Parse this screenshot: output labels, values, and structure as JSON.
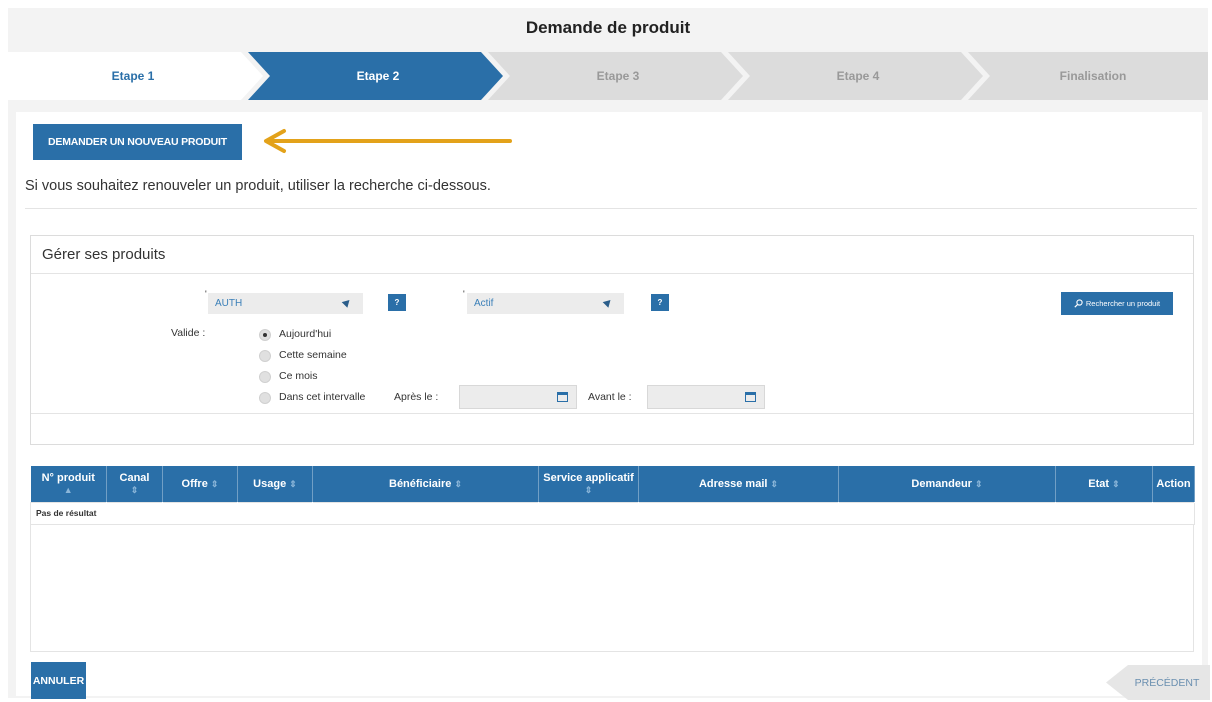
{
  "page": {
    "title": "Demande de produit"
  },
  "steps": [
    {
      "label": "Etape 1",
      "state": "done"
    },
    {
      "label": "Etape 2",
      "state": "active"
    },
    {
      "label": "Etape 3",
      "state": "pending"
    },
    {
      "label": "Etape 4",
      "state": "pending"
    },
    {
      "label": "Finalisation",
      "state": "pending"
    }
  ],
  "actions": {
    "new_product": "DEMANDER UN NOUVEAU PRODUIT"
  },
  "info_text": "Si vous souhaitez renouveler un produit, utiliser la recherche ci-dessous.",
  "panel": {
    "title": "Gérer ses produits",
    "select1": {
      "value": "AUTH",
      "help": "?"
    },
    "select2": {
      "value": "Actif",
      "help": "?"
    },
    "search_button": "Rechercher un produit",
    "valid_label": "Valide :",
    "radios": [
      {
        "label": "Aujourd'hui",
        "checked": true
      },
      {
        "label": "Cette semaine",
        "checked": false
      },
      {
        "label": "Ce mois",
        "checked": false
      },
      {
        "label": "Dans cet intervalle",
        "checked": false
      }
    ],
    "after_label": "Après le :",
    "before_label": "Avant le :"
  },
  "table": {
    "columns": [
      {
        "label": "N° produit",
        "sort": "▲"
      },
      {
        "label": "Canal",
        "sort": "⇕"
      },
      {
        "label": "Offre",
        "sort": "⇕"
      },
      {
        "label": "Usage",
        "sort": "⇕"
      },
      {
        "label": "Bénéficiaire",
        "sort": "⇕"
      },
      {
        "label": "Service applicatif",
        "sort": "⇕"
      },
      {
        "label": "Adresse mail",
        "sort": "⇕"
      },
      {
        "label": "Demandeur",
        "sort": "⇕"
      },
      {
        "label": "Etat",
        "sort": "⇕"
      },
      {
        "label": "Action",
        "sort": ""
      }
    ],
    "empty": "Pas de résultat"
  },
  "footer": {
    "cancel": "ANNULER",
    "previous": "PRÉCÉDENT"
  },
  "colors": {
    "primary": "#2a6fa8",
    "step_pending": "#dcdcdc",
    "annotation_arrow": "#e3a21a"
  }
}
